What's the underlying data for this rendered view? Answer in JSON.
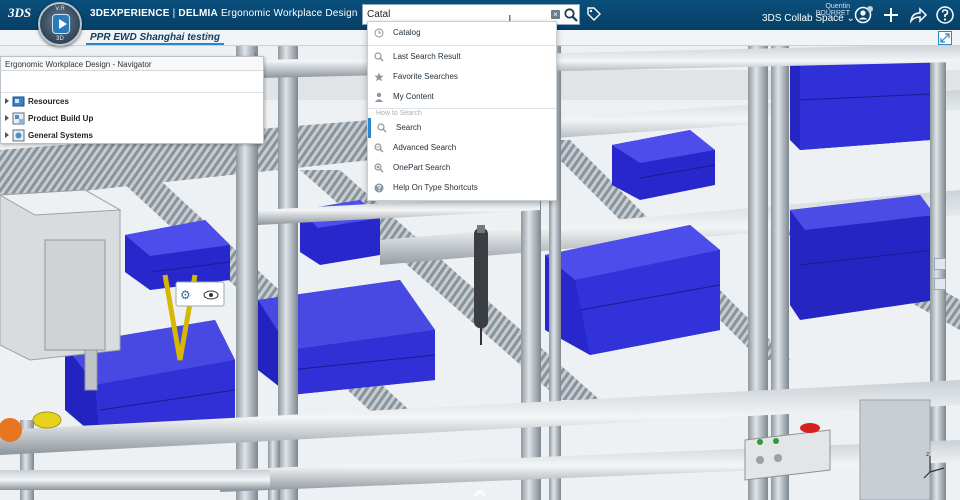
{
  "topbar": {
    "logo": "3DS",
    "compass_top": "V.R",
    "compass_bottom": "3D",
    "brand": "3DEXPERIENCE",
    "separator": " | ",
    "product": "DELMIA",
    "app_name": "Ergonomic Workplace Design",
    "search_value": "Catal",
    "user_name": "Quentin BOURRET",
    "space": "3DS Collab Space"
  },
  "tabs": {
    "active_label": "PPR EWD Shanghai testing",
    "add_label": "+"
  },
  "navigator": {
    "title": "Ergonomic Workplace Design - Navigator",
    "items": [
      {
        "label": "Resources",
        "icon": "resources-icon"
      },
      {
        "label": "Product Build Up",
        "icon": "product-icon"
      },
      {
        "label": "General Systems",
        "icon": "systems-icon"
      }
    ]
  },
  "search_dropdown": {
    "suggestion": "Catalog",
    "recent": [
      "Last Search Result",
      "Favorite Searches",
      "My Content"
    ],
    "how_to_heading": "How to Search",
    "how_to": [
      "Search",
      "Advanced Search",
      "OnePart Search",
      "Help On Type Shortcuts"
    ]
  },
  "colors": {
    "topbar": "#063f66",
    "accent": "#2b88c8",
    "bin_blue": "#2f2fd6",
    "frame_gray": "#9aa3ab"
  }
}
